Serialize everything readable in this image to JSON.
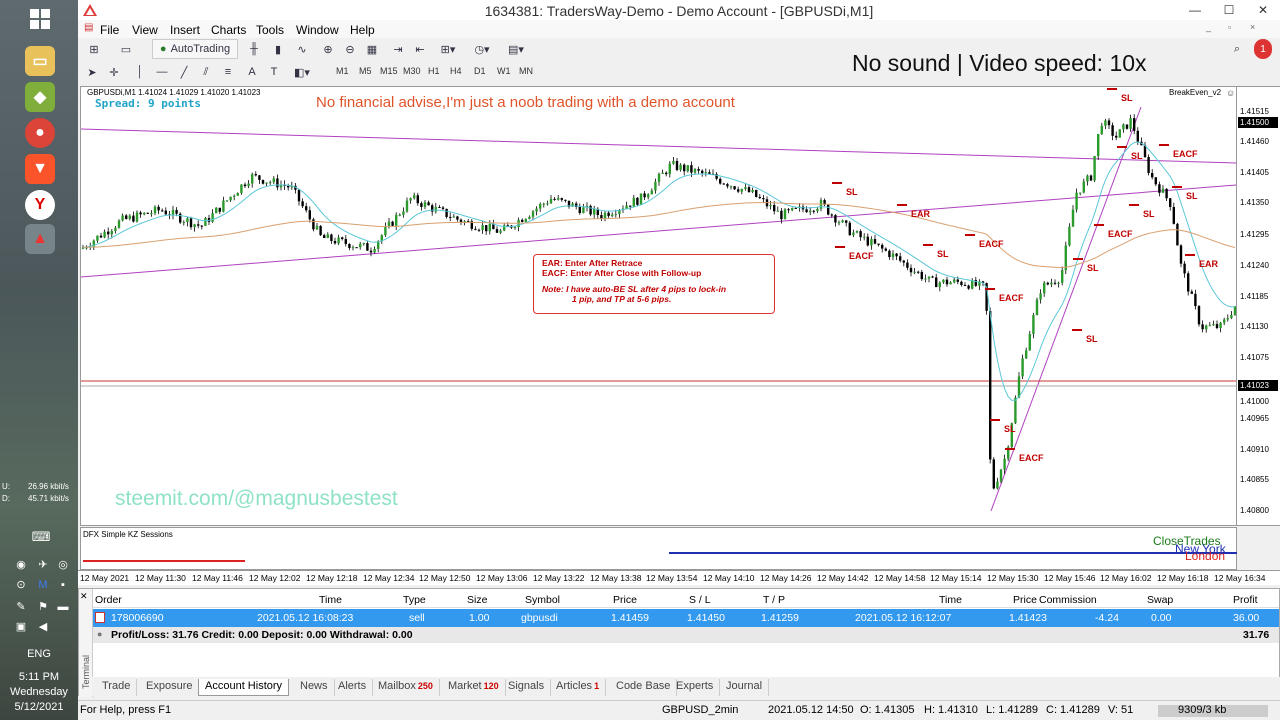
{
  "window": {
    "title": "1634381: TradersWay-Demo - Demo Account - [GBPUSDi,M1]"
  },
  "menu": [
    "File",
    "View",
    "Insert",
    "Charts",
    "Tools",
    "Window",
    "Help"
  ],
  "toolbar": {
    "autotrading": "AutoTrading",
    "timeframes": [
      "M1",
      "M5",
      "M15",
      "M30",
      "H1",
      "H4",
      "D1",
      "W1",
      "MN"
    ]
  },
  "overlay": {
    "video_note": "No sound | Video speed: 10x",
    "disclaimer": "No financial advise,I'm just a noob trading with a demo account",
    "watermark": "steemit.com/@magnusbestest"
  },
  "chart": {
    "symbol_info": "GBPUSDi,M1  1.41024 1.41029 1.41020 1.41023",
    "spread": "Spread: 9 points",
    "ea_name": "BreakEven_v2",
    "legend": {
      "l1": "EAR:   Enter After Retrace",
      "l2": "EACF:  Enter After Close with Follow-up",
      "l3": "Note: I have auto-BE SL after 4 pips to lock-in",
      "l4": "1 pip, and TP at 5-6 pips."
    },
    "price_labels": [
      "1.41515",
      "1.41500",
      "1.41460",
      "1.41405",
      "1.41350",
      "1.41295",
      "1.41240",
      "1.41185",
      "1.41130",
      "1.41075",
      "1.41023",
      "1.41000",
      "1.40965",
      "1.40910",
      "1.40855",
      "1.40800"
    ],
    "highlighted": {
      "p1": "1.41500",
      "p2": "1.41023"
    },
    "annotations": [
      {
        "t": "SL",
        "c": "#c00000"
      },
      {
        "t": "SL",
        "c": "#c00000"
      },
      {
        "t": "EAR",
        "c": "#c00000"
      },
      {
        "t": "EACF",
        "c": "#c00000"
      },
      {
        "t": "SL",
        "c": "#c00000"
      },
      {
        "t": "EACF",
        "c": "#c00000"
      },
      {
        "t": "EACF",
        "c": "#c00000"
      },
      {
        "t": "SL",
        "c": "#c00000"
      },
      {
        "t": "SL",
        "c": "#c00000"
      },
      {
        "t": "EACF",
        "c": "#c00000"
      },
      {
        "t": "SL",
        "c": "#c00000"
      },
      {
        "t": "EACF",
        "c": "#c00000"
      },
      {
        "t": "SL",
        "c": "#c00000"
      },
      {
        "t": "EACF",
        "c": "#c00000"
      },
      {
        "t": "SL",
        "c": "#c00000"
      },
      {
        "t": "SL",
        "c": "#c00000"
      },
      {
        "t": "EAR",
        "c": "#c00000"
      }
    ]
  },
  "indicator": {
    "name": "DFX Simple KZ Sessions",
    "close_trades": "CloseTrades",
    "new_york": "New York",
    "london": "London"
  },
  "time_axis": [
    "12 May 2021",
    "12 May 11:30",
    "12 May 11:46",
    "12 May 12:02",
    "12 May 12:18",
    "12 May 12:34",
    "12 May 12:50",
    "12 May 13:06",
    "12 May 13:22",
    "12 May 13:38",
    "12 May 13:54",
    "12 May 14:10",
    "12 May 14:26",
    "12 May 14:42",
    "12 May 14:58",
    "12 May 15:14",
    "12 May 15:30",
    "12 May 15:46",
    "12 May 16:02",
    "12 May 16:18",
    "12 May 16:34"
  ],
  "terminal": {
    "headers": [
      "Order",
      "Time",
      "Type",
      "Size",
      "Symbol",
      "Price",
      "S / L",
      "T / P",
      "Time",
      "Price",
      "Commission",
      "Swap",
      "Profit"
    ],
    "row": [
      "178006690",
      "2021.05.12 16:08:23",
      "sell",
      "1.00",
      "gbpusdi",
      "1.41459",
      "1.41450",
      "1.41259",
      "2021.05.12 16:12:07",
      "1.41423",
      "-4.24",
      "0.00",
      "36.00"
    ],
    "summary": "Profit/Loss: 31.76  Credit: 0.00  Deposit: 0.00  Withdrawal: 0.00",
    "summary_total": "31.76",
    "side_label": "Terminal"
  },
  "tabs": [
    {
      "l": "Trade"
    },
    {
      "l": "Exposure"
    },
    {
      "l": "Account History"
    },
    {
      "l": "News"
    },
    {
      "l": "Alerts"
    },
    {
      "l": "Mailbox",
      "b": "250"
    },
    {
      "l": "Market",
      "b": "120"
    },
    {
      "l": "Signals"
    },
    {
      "l": "Articles",
      "b": "1"
    },
    {
      "l": "Code Base"
    },
    {
      "l": "Experts"
    },
    {
      "l": "Journal"
    }
  ],
  "status": {
    "help": "For Help, press F1",
    "profile": "GBPUSD_2min",
    "time": "2021.05.12 14:50",
    "o": "O: 1.41305",
    "h": "H: 1.41310",
    "l": "L: 1.41289",
    "c": "C: 1.41289",
    "v": "V: 51",
    "kb": "9309/3 kb"
  },
  "system": {
    "net_u_label": "U:",
    "net_u": "26.96 kbit/s",
    "net_d_label": "D:",
    "net_d": "45.71 kbit/s",
    "lang": "ENG",
    "clock": "5:11 PM",
    "day": "Wednesday",
    "date": "5/12/2021"
  },
  "notification_count": "1"
}
